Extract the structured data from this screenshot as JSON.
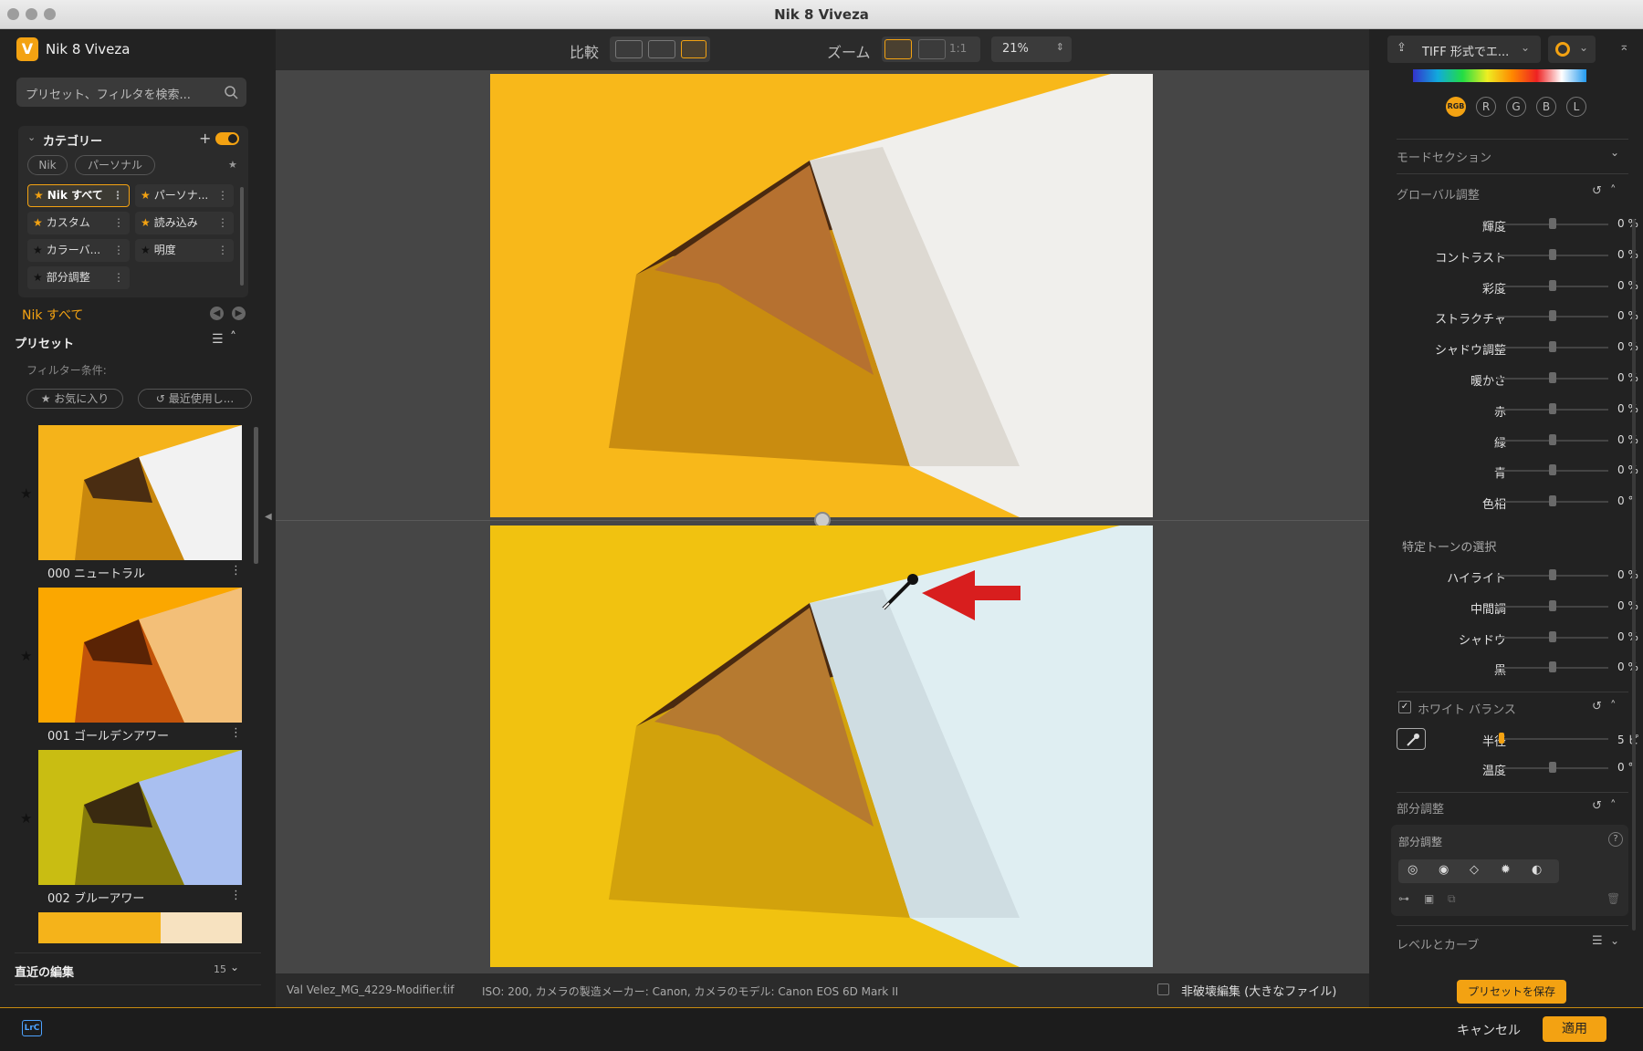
{
  "window": {
    "title": "Nik 8 Viveza"
  },
  "app": {
    "name": "Nik 8 Viveza",
    "logo_letter": "V"
  },
  "search": {
    "placeholder": "プリセット、フィルタを検索..."
  },
  "category": {
    "header": "カテゴリー",
    "chips": [
      "Nik",
      "パーソナル"
    ],
    "items": [
      {
        "label": "Nik すべて",
        "starred": true
      },
      {
        "label": "パーソナ...",
        "starred": true
      },
      {
        "label": "カスタム",
        "starred": true
      },
      {
        "label": "読み込み",
        "starred": true
      },
      {
        "label": "カラーバ...",
        "starred": false
      },
      {
        "label": "明度",
        "starred": false
      },
      {
        "label": "部分調整",
        "starred": false
      }
    ]
  },
  "current_category": "Nik すべて",
  "presets": {
    "header": "プリセット",
    "filter_label": "フィルター条件:",
    "filter_favorites": "お気に入り",
    "filter_recent": "最近使用し...",
    "items": [
      {
        "caption": "000 ニュートラル"
      },
      {
        "caption": "001 ゴールデンアワー"
      },
      {
        "caption": "002 ブルーアワー"
      }
    ]
  },
  "recent": {
    "label": "直近の編集",
    "count": "15"
  },
  "toolbar": {
    "compare_label": "比較",
    "zoom_label": "ズーム",
    "zoom_1to1": "1:1",
    "zoom_value": "21%"
  },
  "status": {
    "filename": "Val Velez_MG_4229-Modifier.tif",
    "exif": "ISO: 200, カメラの製造メーカー: Canon, カメラのモデル: Canon EOS 6D Mark II",
    "nondestructive": "非破壊編集 (大きなファイル)"
  },
  "right": {
    "export": "TIFF 形式でエ...",
    "channels": [
      "RGB",
      "R",
      "G",
      "B",
      "L"
    ],
    "mode_section": "モードセクション",
    "global_header": "グローバル調整",
    "global": [
      {
        "label": "輝度",
        "value": "0 %"
      },
      {
        "label": "コントラスト",
        "value": "0 %"
      },
      {
        "label": "彩度",
        "value": "0 %"
      },
      {
        "label": "ストラクチャ",
        "value": "0 %"
      },
      {
        "label": "シャドウ調整",
        "value": "0 %"
      },
      {
        "label": "暖かさ",
        "value": "0 %"
      },
      {
        "label": "赤",
        "value": "0 %"
      },
      {
        "label": "緑",
        "value": "0 %"
      },
      {
        "label": "青",
        "value": "0 %"
      },
      {
        "label": "色相",
        "value": "0 °"
      }
    ],
    "tone_header": "特定トーンの選択",
    "tones": [
      {
        "label": "ハイライト",
        "value": "0 %"
      },
      {
        "label": "中間調",
        "value": "0 %"
      },
      {
        "label": "シャドウ",
        "value": "0 %"
      },
      {
        "label": "黒",
        "value": "0 %"
      }
    ],
    "wb_header": "ホワイト バランス",
    "wb": [
      {
        "label": "半径",
        "value": "5 ピ"
      },
      {
        "label": "温度",
        "value": "0 °"
      }
    ],
    "partial_header": "部分調整",
    "partial_sub": "部分調整",
    "levels": "レベルとカーブ",
    "save_preset": "プリセットを保存"
  },
  "bottom": {
    "lrc": "LrC",
    "cancel": "キャンセル",
    "apply": "適用"
  },
  "colors": {
    "accent": "#f3a212",
    "bg": "#1c1c1c",
    "panel": "#222222"
  }
}
